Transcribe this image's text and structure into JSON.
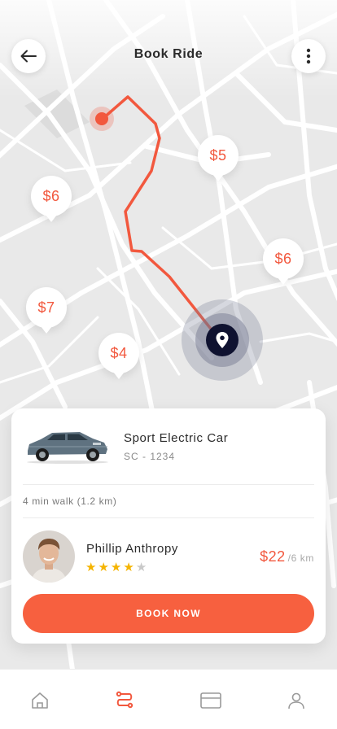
{
  "header": {
    "title": "Book Ride",
    "back_icon": "arrow-left-icon",
    "more_icon": "more-vertical-icon"
  },
  "map": {
    "price_pins": [
      "$5",
      "$6",
      "$6",
      "$7",
      "$4"
    ],
    "route_color": "#f2583e",
    "destination_color": "#0f1230"
  },
  "vehicle": {
    "name": "Sport Electric Car",
    "plate": "SC - 1234"
  },
  "walk_info": "4 min walk (1.2 km)",
  "driver": {
    "name": "Phillip Anthropy",
    "rating": 4,
    "rating_max": 5
  },
  "fare": {
    "amount": "$22",
    "distance": "/6 km"
  },
  "book_button": "BOOK NOW",
  "colors": {
    "accent": "#f7603f",
    "star": "#f5b400"
  },
  "nav": {
    "items": [
      "home-icon",
      "route-icon",
      "card-icon",
      "user-icon"
    ],
    "active_index": 1
  }
}
